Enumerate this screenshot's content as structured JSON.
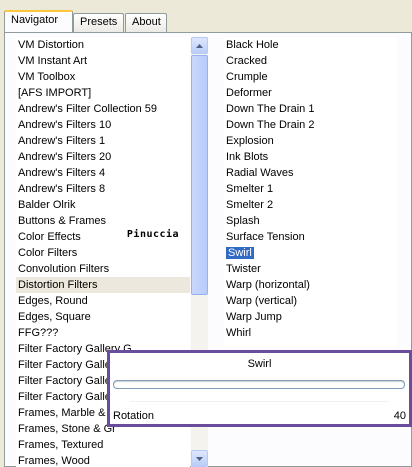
{
  "tabs": [
    "Navigator",
    "Presets",
    "About"
  ],
  "left_list": [
    "VM Distortion",
    "VM Instant Art",
    "VM Toolbox",
    "[AFS IMPORT]",
    "Andrew's Filter Collection 59",
    "Andrew's Filters 10",
    "Andrew's Filters 1",
    "Andrew's Filters 20",
    "Andrew's Filters 4",
    "Andrew's Filters 8",
    "Balder Olrik",
    "Buttons & Frames",
    "Color Effects",
    "Color Filters",
    "Convolution Filters",
    "Distortion Filters",
    "Edges, Round",
    "Edges, Square",
    "FFG???",
    "Filter Factory Gallery G",
    "Filter Factory Gallery",
    "Filter Factory Gallery",
    "Filter Factory Gallery",
    "Frames, Marble & C",
    "Frames, Stone & Gr",
    "Frames, Textured",
    "Frames, Wood"
  ],
  "right_list": [
    "Black Hole",
    "Cracked",
    "Crumple",
    "Deformer",
    "Down The Drain 1",
    "Down The Drain 2",
    "Explosion",
    "Ink Blots",
    "Radial Waves",
    "Smelter 1",
    "Smelter 2",
    "Splash",
    "Surface Tension",
    "Swirl",
    "Twister",
    "Warp (horizontal)",
    "Warp (vertical)",
    "Warp Jump",
    "Whirl"
  ],
  "left_highlighted": "Distortion Filters",
  "right_selected": "Swirl",
  "watermark": "Pinuccia",
  "swirl_dialog": {
    "title": "Swirl",
    "param_label": "Rotation",
    "param_value": "40"
  },
  "colors": {
    "selection": "#316ac5",
    "dialog_border": "#6a4c9c",
    "active_tab_accent": "#ffc83c"
  }
}
